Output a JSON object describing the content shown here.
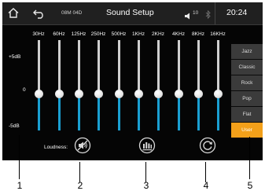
{
  "topbar": {
    "home_icon": "home-icon",
    "back_icon": "back-arrow-icon",
    "date": "08M 04D",
    "title": "Sound Setup",
    "volume_icon": "speaker-icon",
    "volume": "10",
    "bluetooth_icon": "bluetooth-icon",
    "time": "20:24"
  },
  "equalizer": {
    "scale": {
      "top": "+5dB",
      "mid": "0",
      "bottom": "-5dB"
    },
    "bands": [
      {
        "label": "30Hz",
        "level": 0
      },
      {
        "label": "60Hz",
        "level": 0
      },
      {
        "label": "125Hz",
        "level": 0
      },
      {
        "label": "250Hz",
        "level": 0
      },
      {
        "label": "500Hz",
        "level": 0
      },
      {
        "label": "1KHz",
        "level": 0
      },
      {
        "label": "2KHz",
        "level": 0
      },
      {
        "label": "4KHz",
        "level": 0
      },
      {
        "label": "8KHz",
        "level": 0
      },
      {
        "label": "16KHz",
        "level": 0
      }
    ]
  },
  "presets": {
    "items": [
      "Jazz",
      "Classic",
      "Rock",
      "Pop",
      "Flat",
      "User"
    ],
    "selected": "User"
  },
  "controls": {
    "loudness_label": "Loudness:",
    "loudness_icon": "speaker-muted-icon",
    "equalizer_icon": "equalizer-icon",
    "reset_icon": "refresh-icon"
  },
  "callouts": [
    "1",
    "2",
    "3",
    "4",
    "5"
  ],
  "colors": {
    "accent": "#1a9fd1",
    "preset_active": "#f3a01a",
    "background": "#050505"
  }
}
